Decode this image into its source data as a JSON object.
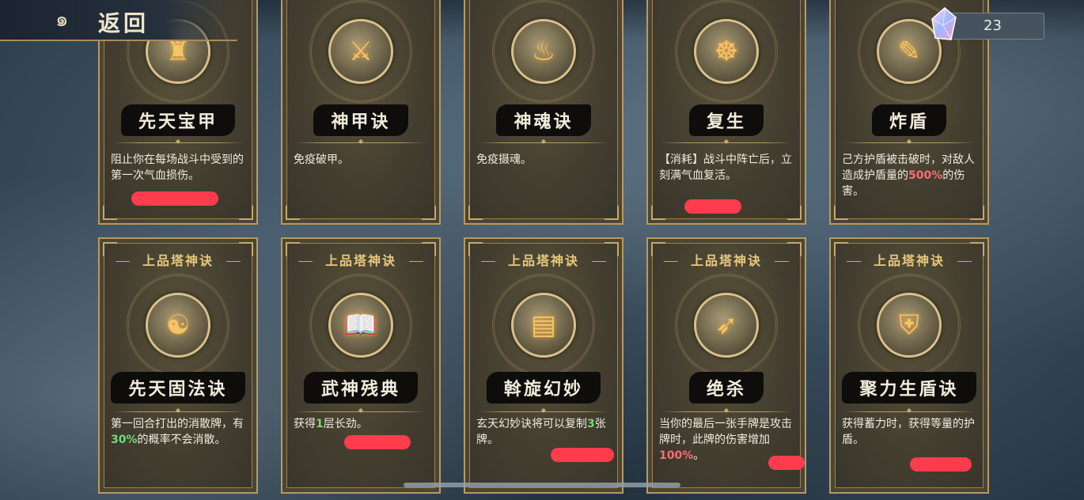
{
  "nav": {
    "back_label": "返回",
    "back_icon": "cloud-swirl-icon"
  },
  "currency": {
    "amount": "23",
    "icon": "crystal-icon"
  },
  "top_cards": [
    {
      "name": "先天宝甲",
      "icon": "armor-icon",
      "desc": "阻止你在每场战斗中受到的第一次气血损伤。"
    },
    {
      "name": "神甲诀",
      "icon": "shield-sword-icon",
      "desc": "免疫破甲。"
    },
    {
      "name": "神魂诀",
      "icon": "flame-spirit-icon",
      "desc": "免疫摄魂。"
    },
    {
      "name": "复生",
      "icon": "meditation-icon",
      "desc": "【消耗】战斗中阵亡后，立刻满气血复活。"
    },
    {
      "name": "炸盾",
      "icon": "scroll-sword-icon",
      "desc_pre": "己方护盾被击破时，对敌人造成护盾量的",
      "desc_hl": "500%",
      "desc_post": "的伤害。"
    }
  ],
  "bottom_cards": [
    {
      "banner": "上品塔神诀",
      "name": "先天固法诀",
      "icon": "vortex-icon",
      "desc_pre": "第一回合打出的消散牌，有",
      "desc_hl": "30%",
      "desc_post": "的概率不会消散。"
    },
    {
      "banner": "上品塔神诀",
      "name": "武神残典",
      "icon": "book-sword-icon",
      "desc_pre": "获得",
      "desc_hl": "1",
      "desc_post": "层长劲。"
    },
    {
      "banner": "上品塔神诀",
      "name": "斡旋幻妙",
      "icon": "cards-icon",
      "desc_pre": "玄天幻妙诀将可以复制",
      "desc_hl": "3",
      "desc_post": "张牌。"
    },
    {
      "banner": "上品塔神诀",
      "name": "绝杀",
      "icon": "bow-sword-icon",
      "desc_pre": "当你的最后一张手牌是攻击牌时，此牌的伤害增加",
      "desc_hl": "100%",
      "desc_post": "。"
    },
    {
      "banner": "上品塔神诀",
      "name": "聚力生盾诀",
      "icon": "shield-icon",
      "desc": "获得蓄力时，获得等量的护盾。"
    }
  ]
}
